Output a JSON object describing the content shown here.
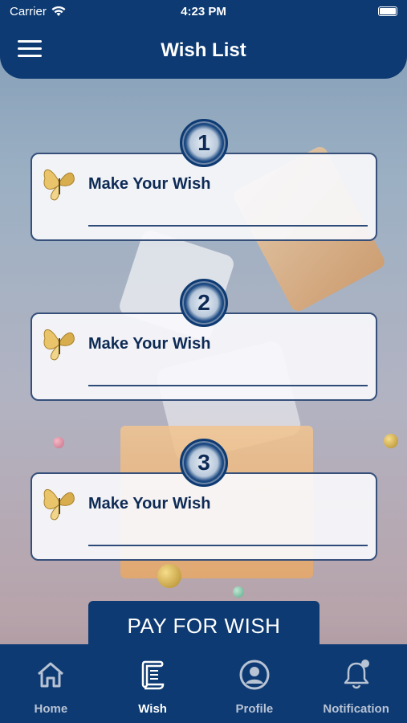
{
  "status_bar": {
    "carrier": "Carrier",
    "time": "4:23 PM"
  },
  "header": {
    "title": "Wish List",
    "menu_icon": "hamburger-menu-icon"
  },
  "wishes": [
    {
      "number": "1",
      "label": "Make Your Wish",
      "icon": "butterfly-icon"
    },
    {
      "number": "2",
      "label": "Make Your Wish",
      "icon": "butterfly-icon"
    },
    {
      "number": "3",
      "label": "Make Your Wish",
      "icon": "butterfly-icon"
    }
  ],
  "pay_button": {
    "label": "PAY FOR WISH"
  },
  "tabs": [
    {
      "label": "Home",
      "icon": "home-icon",
      "active": false
    },
    {
      "label": "Wish",
      "icon": "scroll-icon",
      "active": true
    },
    {
      "label": "Profile",
      "icon": "profile-icon",
      "active": false
    },
    {
      "label": "Notification",
      "icon": "bell-icon",
      "active": false
    }
  ],
  "colors": {
    "primary": "#0d3a72",
    "accent_text": "#0d2a55",
    "inactive_tab": "#b8c3d4"
  }
}
